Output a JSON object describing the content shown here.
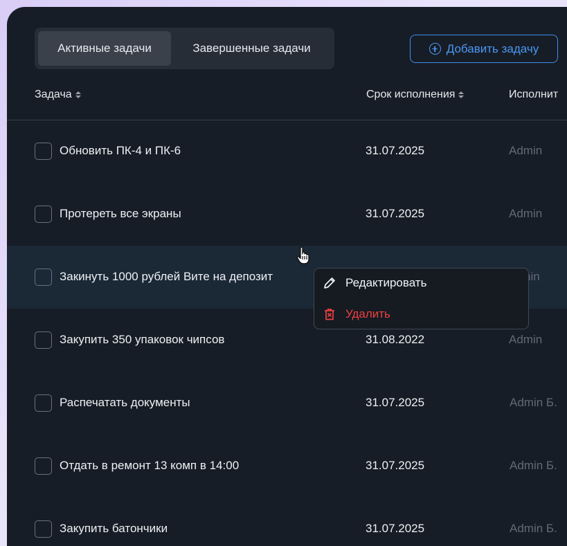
{
  "tabs": {
    "active_label": "Активные задачи",
    "completed_label": "Завершенные задачи"
  },
  "add_button": {
    "label": "Добавить задачу",
    "icon": "plus-circle-icon"
  },
  "columns": {
    "task": "Задача",
    "due": "Срок исполнения",
    "assignee": "Исполнит"
  },
  "rows": [
    {
      "task": "Обновить ПК-4 и ПК-6",
      "due": "31.07.2025",
      "assignee": "Admin"
    },
    {
      "task": "Протереть все экраны",
      "due": "31.07.2025",
      "assignee": "Admin"
    },
    {
      "task": "Закинуть 1000 рублей Вите на депозит",
      "due": "",
      "assignee": "nin"
    },
    {
      "task": "Закупить 350 упаковок чипсов",
      "due": "31.08.2022",
      "assignee": "Admin"
    },
    {
      "task": "Распечатать документы",
      "due": "31.07.2025",
      "assignee": "Admin Б."
    },
    {
      "task": "Отдать в ремонт 13 комп в 14:00",
      "due": "31.07.2025",
      "assignee": "Admin Б."
    },
    {
      "task": "Закупить батончики",
      "due": "31.07.2025",
      "assignee": "Admin Б."
    }
  ],
  "context_menu": {
    "edit_label": "Редактировать",
    "delete_label": "Удалить",
    "edit_icon": "pencil-icon",
    "delete_icon": "trash-icon"
  },
  "colors": {
    "accent": "#3f8ef0",
    "danger": "#ef4040",
    "panel": "#171d26",
    "row_highlight": "#1b2836"
  }
}
